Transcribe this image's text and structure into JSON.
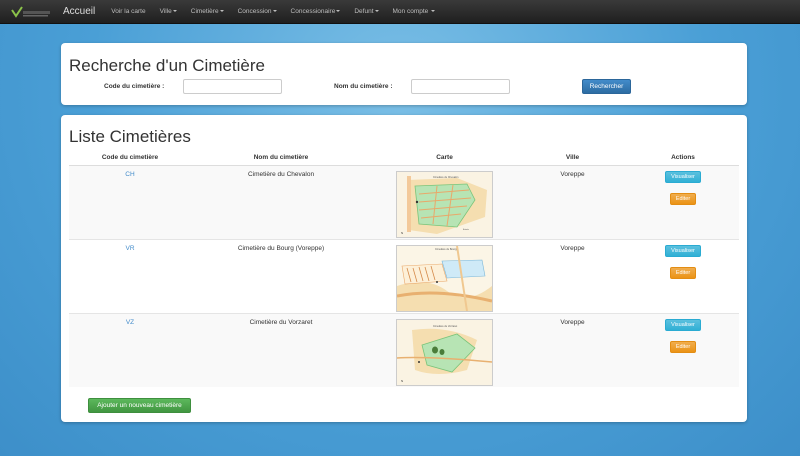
{
  "navbar": {
    "brand": "Accueil",
    "items": [
      {
        "label": "Voir la carte",
        "dropdown": false
      },
      {
        "label": "Ville",
        "dropdown": true
      },
      {
        "label": "Cimetière",
        "dropdown": true
      },
      {
        "label": "Concession",
        "dropdown": true
      },
      {
        "label": "Concessionaire",
        "dropdown": true
      },
      {
        "label": "Defunt",
        "dropdown": true
      },
      {
        "label": "Mon compte",
        "dropdown": true
      }
    ]
  },
  "search": {
    "title": "Recherche d'un Cimetière",
    "code_label": "Code du cimetière :",
    "code_value": "",
    "name_label": "Nom du cimetière :",
    "name_value": "",
    "button": "Rechercher"
  },
  "list": {
    "title": "Liste Cimetières",
    "columns": [
      "Code du cimetière",
      "Nom du cimetière",
      "Carte",
      "Ville",
      "Actions"
    ],
    "rows": [
      {
        "code": "CH",
        "name": "Cimetière du Chevalon",
        "ville": "Voreppe",
        "view": "Visualiser",
        "edit": "Editer"
      },
      {
        "code": "VR",
        "name": "Cimetière du Bourg (Voreppe)",
        "ville": "Voreppe",
        "view": "Visualiser",
        "edit": "Editer"
      },
      {
        "code": "VZ",
        "name": "Cimetière du Vorzaret",
        "ville": "Voreppe",
        "view": "Visualiser",
        "edit": "Editer"
      }
    ],
    "add_button": "Ajouter un nouveau cimetière"
  },
  "colors": {
    "primary": "#428bca",
    "info": "#5bc0de",
    "warning": "#f0ad4e",
    "success": "#5cb85c"
  }
}
